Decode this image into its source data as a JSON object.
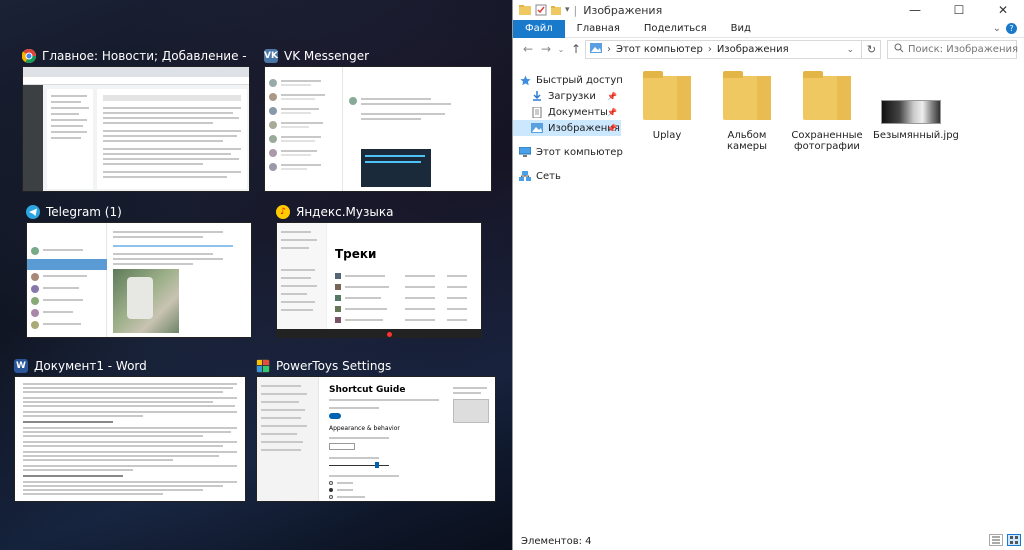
{
  "task_view": {
    "windows": [
      {
        "title": "Главное: Новости; Добавление - www.iguides.ru - G...",
        "icon": "chrome-icon",
        "color": "#db4437"
      },
      {
        "title": "VK Messenger",
        "icon": "vk-icon",
        "color": "#4a76a8"
      },
      {
        "title": "Telegram (1)",
        "icon": "telegram-icon",
        "color": "#2ca5e0"
      },
      {
        "title": "Яндекс.Музыка",
        "icon": "yandex-music-icon",
        "color": "#ffcc00"
      },
      {
        "title": "Документ1 - Word",
        "icon": "word-icon",
        "color": "#2b579a"
      },
      {
        "title": "PowerToys Settings",
        "icon": "powertoys-icon",
        "color": "#f4c20d"
      }
    ],
    "thumbs": {
      "music_heading": "Треки",
      "powertoys_heading": "Shortcut Guide",
      "powertoys_sub": "Appearance & behavior"
    }
  },
  "explorer": {
    "title": "Изображения",
    "ribbon_tabs": [
      "Файл",
      "Главная",
      "Поделиться",
      "Вид"
    ],
    "breadcrumb": [
      "Этот компьютер",
      "Изображения"
    ],
    "search_placeholder": "Поиск: Изображения",
    "nav": [
      {
        "label": "Быстрый доступ",
        "icon": "star-icon"
      },
      {
        "label": "Загрузки",
        "icon": "download-icon"
      },
      {
        "label": "Документы",
        "icon": "documents-icon"
      },
      {
        "label": "Изображения",
        "icon": "pictures-icon"
      },
      {
        "label": "Этот компьютер",
        "icon": "computer-icon"
      },
      {
        "label": "Сеть",
        "icon": "network-icon"
      }
    ],
    "items": [
      {
        "label": "Uplay",
        "type": "folder"
      },
      {
        "label": "Альбом камеры",
        "type": "folder"
      },
      {
        "label": "Сохраненные фотографии",
        "type": "folder"
      },
      {
        "label": "Безымянный.jpg",
        "type": "image"
      }
    ],
    "status": "Элементов: 4",
    "accent": "#1979ca"
  }
}
